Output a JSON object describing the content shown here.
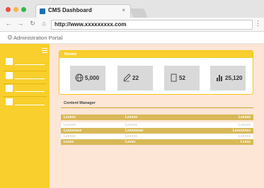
{
  "browser": {
    "tab_title": "CMS Dashboard",
    "tab_close": "×",
    "url": "http://www.xxxxxxxxx.com",
    "nav_icons": [
      "arrow-left-icon",
      "arrow-right-icon",
      "reload-icon",
      "home-icon"
    ],
    "nav_glyphs": [
      "←",
      "→",
      "↻",
      "⌂"
    ],
    "menu_glyph": "⋮"
  },
  "app": {
    "title": "Administration Portal",
    "logo_glyph": "⚙"
  },
  "sidebar": {
    "items": [
      {
        "label": ""
      },
      {
        "label": ""
      },
      {
        "label": ""
      },
      {
        "label": ""
      }
    ]
  },
  "review": {
    "title": "Review",
    "stats": [
      {
        "icon": "globe-icon",
        "value": "5,000"
      },
      {
        "icon": "pencil-icon",
        "value": "22"
      },
      {
        "icon": "document-icon",
        "value": "52"
      },
      {
        "icon": "bar-chart-icon",
        "value": "25,120"
      }
    ]
  },
  "content_manager": {
    "title": "Content Manager",
    "rows": [
      [
        "Lxxxxx",
        "Lxxxxx",
        "Lxxxxx"
      ],
      [
        "Lxxxxx",
        "Lxxxxx",
        "Lxxxxx"
      ],
      [
        "Lxxxxxxxx",
        "Lxxxxxxxx",
        "Lxxxxxxxx"
      ],
      [
        "Lxxxxx",
        "Lxxxxx",
        "Lxxxxx"
      ],
      [
        "Lxxxx",
        "Lxxxx",
        "Lxxxx"
      ]
    ]
  },
  "colors": {
    "accent": "#f8cf2c",
    "main_bg": "#fde6d6",
    "table_dark": "#d8b858"
  }
}
